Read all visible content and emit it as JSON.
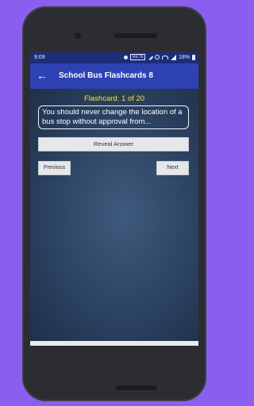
{
  "status_bar": {
    "time": "9:09",
    "battery_percent": "18%",
    "network_label": "VoLTE"
  },
  "app_bar": {
    "title": "School Bus Flashcards 8",
    "back_icon": "arrow-left"
  },
  "flashcard": {
    "counter": "Flashcard: 1 of 20",
    "question": "You should never change the location of a bus stop without approval from..."
  },
  "buttons": {
    "reveal": "Reveal Answer",
    "previous": "Previous",
    "next": "Next"
  },
  "colors": {
    "background": "#8a5ff0",
    "app_bar": "#2e42b3",
    "status_bar": "#1e2d7a",
    "counter_text": "#f2e13a",
    "content_bg": "#2c4363"
  }
}
